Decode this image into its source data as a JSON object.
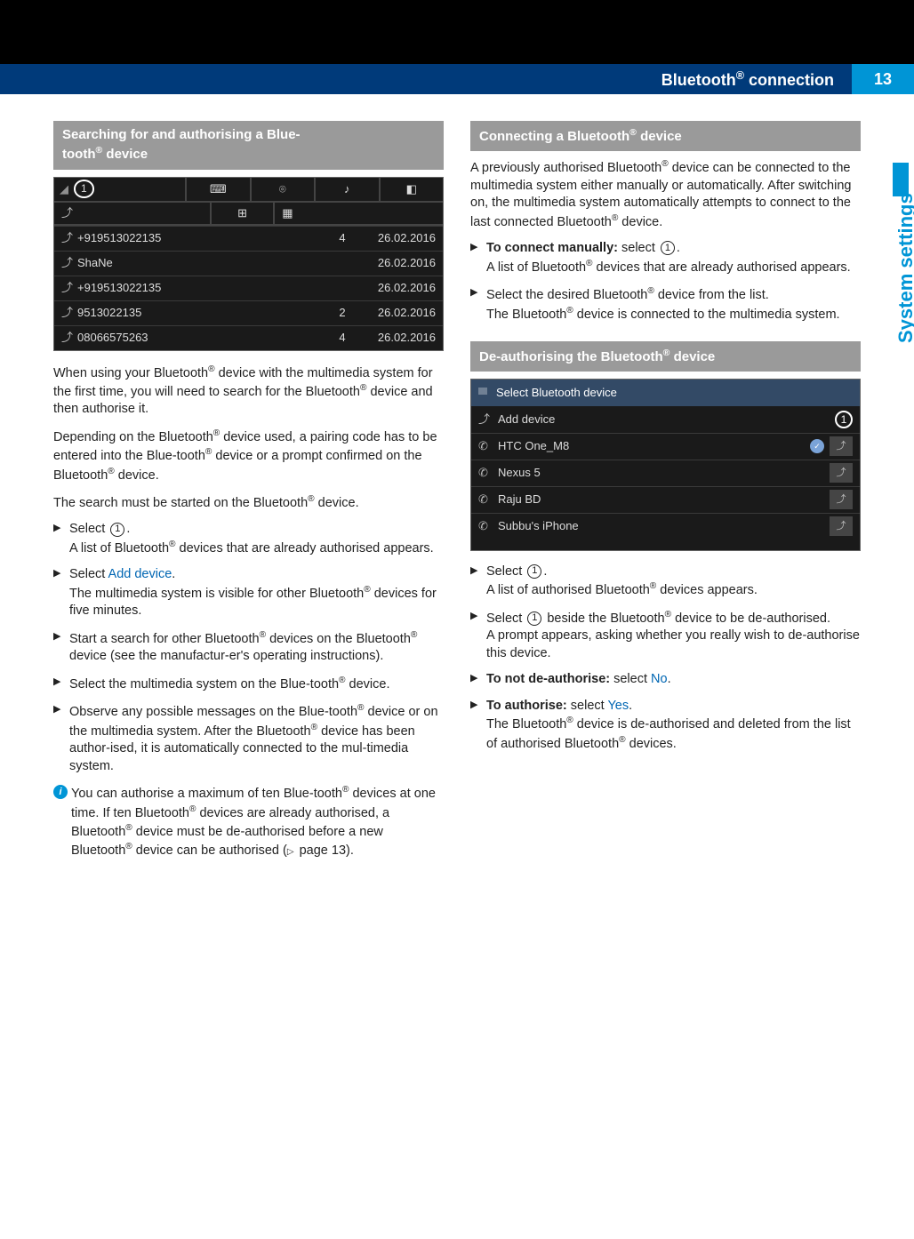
{
  "header": {
    "title_pre": "Bluetooth",
    "title_post": " connection",
    "page_number": "13"
  },
  "side_tab": "System settings",
  "left": {
    "heading_pre": "Searching for and authorising a Blue-",
    "heading_post": "tooth",
    "heading_after_sup": " device",
    "screenshot_rows": [
      {
        "name": "+919513022135",
        "count": "4",
        "date": "26.02.2016"
      },
      {
        "name": "ShaNe",
        "count": "",
        "date": "26.02.2016"
      },
      {
        "name": "+919513022135",
        "count": "",
        "date": "26.02.2016"
      },
      {
        "name": "9513022135",
        "count": "2",
        "date": "26.02.2016"
      },
      {
        "name": "08066575263",
        "count": "4",
        "date": "26.02.2016"
      }
    ],
    "p1a": "When using your Bluetooth",
    "p1b": " device with the multimedia system for the first time, you will need to search for the Bluetooth",
    "p1c": " device and then authorise it.",
    "p2a": "Depending on the Bluetooth",
    "p2b": " device used, a pairing code has to be entered into the Blue-tooth",
    "p2c": " device or a prompt confirmed on the Bluetooth",
    "p2d": " device.",
    "p3a": "The search must be started on the Bluetooth",
    "p3b": " device.",
    "steps": {
      "s1a": "Select ",
      "s1b": ".",
      "s1_result_a": "A list of Bluetooth",
      "s1_result_b": " devices that are already authorised appears.",
      "s2a": "Select ",
      "s2_link": "Add device",
      "s2b": ".",
      "s2_result_a": "The multimedia system is visible for other Bluetooth",
      "s2_result_b": " devices for five minutes.",
      "s3a": "Start a search for other Bluetooth",
      "s3b": " devices on the Bluetooth",
      "s3c": " device (see the manufactur-er's operating instructions).",
      "s4a": "Select the multimedia system on the Blue-tooth",
      "s4b": " device.",
      "s5a": "Observe any possible messages on the Blue-tooth",
      "s5b": " device or on the multimedia system. After the Bluetooth",
      "s5c": " device has been author-ised, it is automatically connected to the mul-timedia system."
    },
    "note_a": "You can authorise a maximum of ten Blue-tooth",
    "note_b": " devices at one time. If ten Bluetooth",
    "note_c": " devices are already authorised, a Bluetooth",
    "note_d": " device must be de-authorised before a new Bluetooth",
    "note_e": " device can be authorised (",
    "note_pageref": " page 13).",
    "circle1": "1"
  },
  "right": {
    "h1_pre": "Connecting a Bluetooth",
    "h1_post": " device",
    "p1a": "A previously authorised Bluetooth",
    "p1b": " device can be connected to the multimedia system either manually or automatically. After switching on, the multimedia system automatically attempts to connect to the last connected Bluetooth",
    "p1c": " device.",
    "steps1": {
      "s1_bold": "To connect manually:",
      "s1a": " select ",
      "s1b": ".",
      "s1_result_a": "A list of Bluetooth",
      "s1_result_b": " devices that are already authorised appears.",
      "s2a": "Select the desired Bluetooth",
      "s2b": " device from the list.",
      "s2_result_a": "The Bluetooth",
      "s2_result_b": " device is connected to the multimedia system."
    },
    "h2_pre": "De-authorising the Bluetooth",
    "h2_post": " device",
    "sel_title": "Select Bluetooth device",
    "sel_rows": [
      {
        "name": "Add device",
        "badge": "",
        "end": "",
        "circle": "1"
      },
      {
        "name": "HTC One_M8",
        "badge": "✓",
        "end": "⤴"
      },
      {
        "name": "Nexus 5",
        "badge": "",
        "end": "⤴"
      },
      {
        "name": "Raju BD",
        "badge": "",
        "end": "⤴"
      },
      {
        "name": "Subbu's iPhone",
        "badge": "",
        "end": "⤴"
      }
    ],
    "steps2": {
      "s1a": "Select ",
      "s1b": ".",
      "s1_result_a": "A list of authorised Bluetooth",
      "s1_result_b": " devices appears.",
      "s2a": "Select ",
      "s2b": " beside the Bluetooth",
      "s2c": " device to be de-authorised.",
      "s2_result": "A prompt appears, asking whether you really wish to de-authorise this device.",
      "s3_bold": "To not de-authorise:",
      "s3a": " select ",
      "s3_link": "No",
      "s3b": ".",
      "s4_bold": "To authorise:",
      "s4a": " select ",
      "s4_link": "Yes",
      "s4b": ".",
      "s4_result_a": "The Bluetooth",
      "s4_result_b": " device is de-authorised and deleted from the list of authorised Bluetooth",
      "s4_result_c": " devices."
    }
  }
}
